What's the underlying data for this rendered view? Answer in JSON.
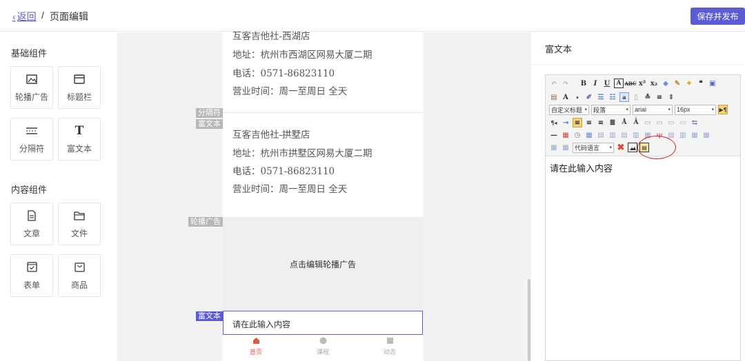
{
  "header": {
    "back_label": "返回",
    "separator": "/",
    "title": "页面编辑",
    "publish_label": "保存并发布"
  },
  "sidebar": {
    "basic_title": "基础组件",
    "basic_items": [
      {
        "label": "轮播广告",
        "icon": "image-icon"
      },
      {
        "label": "标题栏",
        "icon": "title-bar-icon"
      },
      {
        "label": "分隔符",
        "icon": "divider-icon"
      },
      {
        "label": "富文本",
        "icon": "text-icon"
      }
    ],
    "content_title": "内容组件",
    "content_items": [
      {
        "label": "文章",
        "icon": "article-icon"
      },
      {
        "label": "文件",
        "icon": "folder-icon"
      },
      {
        "label": "表单",
        "icon": "form-icon"
      },
      {
        "label": "商品",
        "icon": "bag-icon"
      }
    ]
  },
  "canvas": {
    "store1": {
      "name": "互客吉他社-西湖店",
      "address": "地址：杭州市西湖区网易大厦二期",
      "phone": "电话：0571-86823110",
      "hours": "营业时间：周一至周日 全天"
    },
    "store2": {
      "name": "互客吉他社-拱墅店",
      "address": "地址：杭州市拱墅区网易大厦二期",
      "phone": "电话：0571-86823110",
      "hours": "营业时间：周一至周日 全天"
    },
    "tags": {
      "divider": "分隔符",
      "richtext1": "富文本",
      "banner": "轮播广告",
      "richtext2": "富文本"
    },
    "banner_text": "点击编辑轮播广告",
    "richtext_placeholder": "请在此输入内容",
    "tabs": [
      {
        "label": "首页",
        "active": true
      },
      {
        "label": "课程",
        "active": false
      },
      {
        "label": "动态",
        "active": false
      }
    ]
  },
  "right_panel": {
    "title": "富文本",
    "toolbar": {
      "custom_heading": "自定义标题",
      "paragraph": "段落",
      "font": "arial",
      "font_size": "16px",
      "code_language": "代码语言"
    },
    "editor_placeholder": "请在此输入内容"
  },
  "colors": {
    "accent": "#5b5bd6",
    "active_tab": "#e05a3e",
    "annotation": "#d42020"
  }
}
